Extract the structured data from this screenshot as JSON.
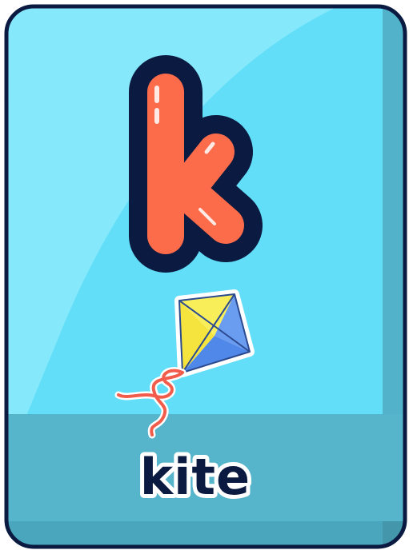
{
  "card": {
    "letter": "k",
    "word": "kite",
    "picture": "kite-illustration"
  },
  "colors": {
    "card_fill": "#62def8",
    "card_highlight": "#86e8fb",
    "card_shadow": "#52b2ca",
    "card_outline": "#0b1a40",
    "footer_band": "#56b5cb",
    "letter_fill": "#fc6b4a",
    "letter_outline": "#0b1a40",
    "kite_yellow": "#f8ee5a",
    "kite_blue": "#4f88e9",
    "kite_string": "#f25c4a",
    "word_fill": "#0b1a40"
  }
}
